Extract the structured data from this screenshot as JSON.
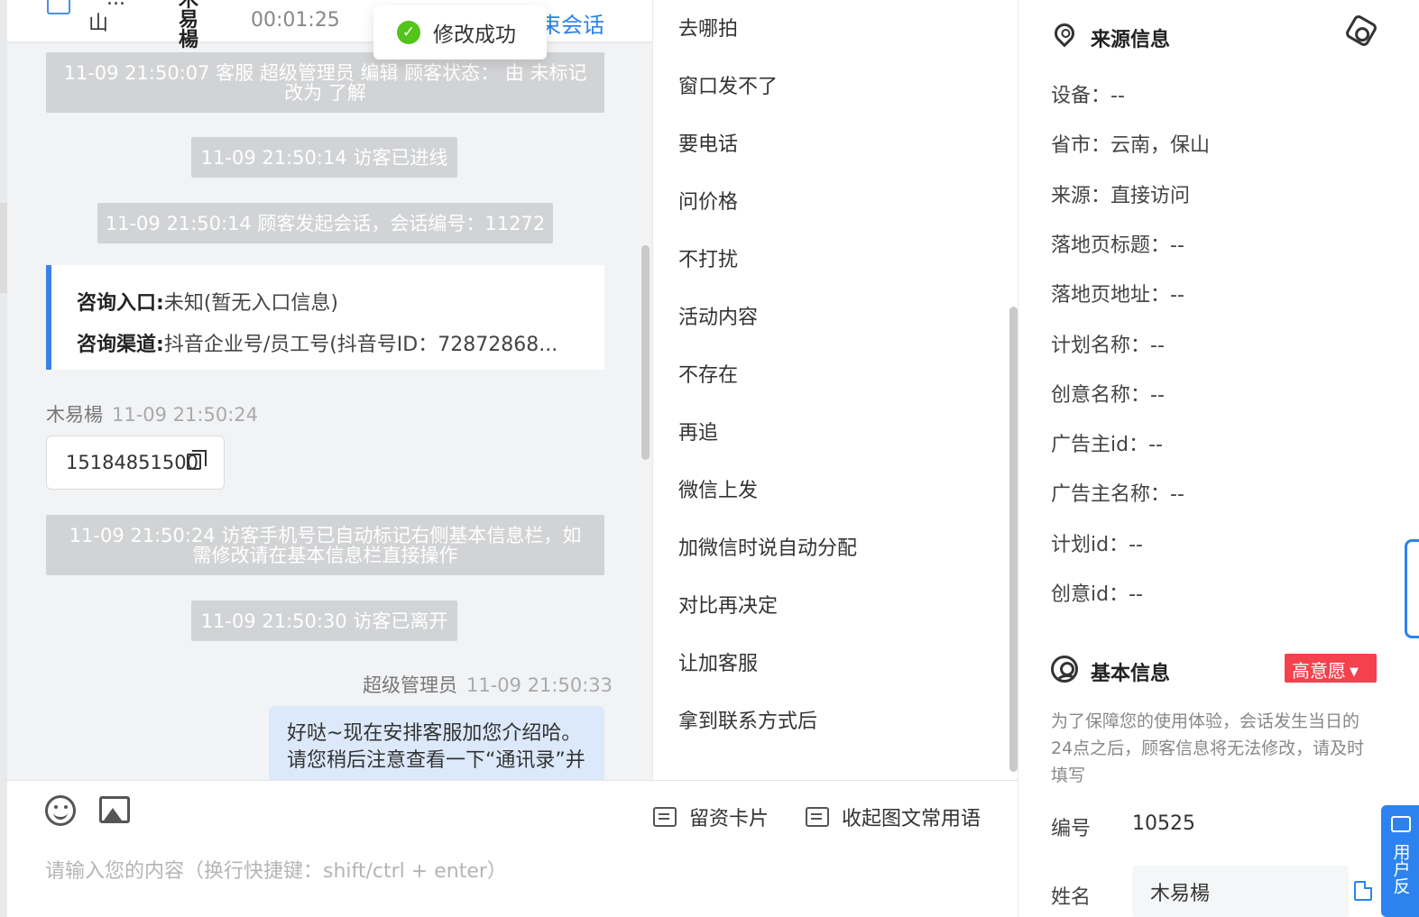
{
  "chat": {
    "header": {
      "city_top": "...",
      "city": "山",
      "name": "木易楊",
      "duration": "00:01:25",
      "end_session": "束会话"
    },
    "toast": "修改成功",
    "messages": [
      {
        "id": "m1",
        "text_line1": "11-09 21:50:07 客服 超级管理员 编辑 顾客状态： 由 未标记",
        "text_line2": "改为 了解"
      },
      {
        "id": "m2",
        "text": "11-09 21:50:14 访客已进线"
      },
      {
        "id": "m3",
        "text": "11-09 21:50:14 顾客发起会话，会话编号：11272"
      },
      {
        "id": "m5",
        "text_line1": "11-09 21:50:24 访客手机号已自动标记右侧基本信息栏，如",
        "text_line2": "需修改请在基本信息栏直接操作"
      },
      {
        "id": "m6",
        "text": "11-09 21:50:30 访客已离开"
      }
    ],
    "info_card": {
      "entry_label": "咨询入口:",
      "entry_value": "未知(暂无入口信息)",
      "channel_label": "咨询渠道:",
      "channel_value": "抖音企业号/员工号(抖音号ID：72872868..."
    },
    "visitor_msg": {
      "sender": "木易楊",
      "time": "11-09 21:50:24",
      "phone": "15184851500"
    },
    "agent_msg": {
      "sender": "超级管理员",
      "time": "11-09 21:50:33",
      "line1": "好哒~现在安排客服加您介绍哈。",
      "line2": "请您稍后注意查看一下“通讯录”并",
      "line3": "..."
    }
  },
  "input": {
    "placeholder": "请输入您的内容（换行快捷键：shift/ctrl + enter）",
    "lead_card_label": "留资卡片",
    "collapse_label": "收起图文常用语"
  },
  "phrases": [
    "去哪拍",
    "窗口发不了",
    "要电话",
    "问价格",
    "不打扰",
    "活动内容",
    "不存在",
    "再追",
    "微信上发",
    "加微信时说自动分配",
    "对比再决定",
    "让加客服",
    "拿到联系方式后"
  ],
  "source_info": {
    "title": "来源信息",
    "fields": [
      "设备：--",
      "省市：云南，保山",
      "来源：直接访问",
      "落地页标题：--",
      "落地页地址：--",
      "计划名称：--",
      "创意名称：--",
      "广告主id：--",
      "广告主名称：--",
      "计划id：--",
      "创意id：--"
    ]
  },
  "basic_info": {
    "title": "基本信息",
    "intent_badge": "高意愿",
    "notice": "为了保障您的使用体验，会话发生当日的24点之后，顾客信息将无法修改，请及时填写",
    "id_label": "编号",
    "id_value": "10525",
    "name_label": "姓名",
    "name_value": "木易楊"
  },
  "feedback_tab": "用户反",
  "colors": {
    "accent": "#2c83f0",
    "success": "#52c41a",
    "badge": "#f5404d",
    "sys_bg": "#d2d3d5",
    "agent_bubble": "#dce9fb"
  }
}
